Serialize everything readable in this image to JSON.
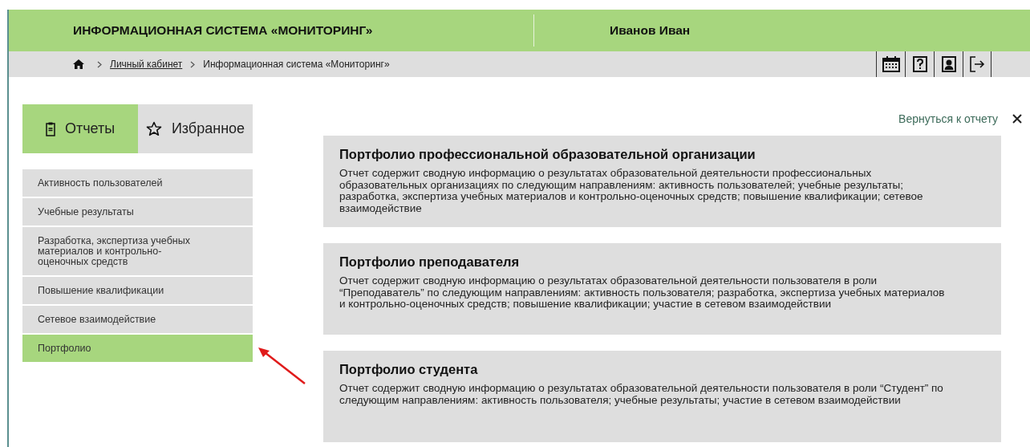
{
  "header": {
    "title": "ИНФОРМАЦИОННАЯ СИСТЕМА «МОНИТОРИНГ»",
    "user": "Иванов Иван"
  },
  "breadcrumbs": [
    {
      "label": "Личный кабинет",
      "link": true
    },
    {
      "label": "Информационная система «Мониторинг»",
      "link": false
    }
  ],
  "tabs": [
    {
      "label": "Отчеты",
      "kind": "reports",
      "selected": true
    },
    {
      "label": "Избранное",
      "kind": "favorites",
      "selected": false
    }
  ],
  "menu": [
    {
      "label": "Активность пользователей",
      "selected": false
    },
    {
      "label": "Учебные результаты",
      "selected": false
    },
    {
      "label": "Разработка, экспертиза учебных материалов и контрольно-оценочных средств",
      "selected": false
    },
    {
      "label": "Повышение квалификации",
      "selected": false
    },
    {
      "label": "Сетевое взаимодействие",
      "selected": false
    },
    {
      "label": "Портфолио",
      "selected": true
    }
  ],
  "back_link": "Вернуться к отчету",
  "cards": [
    {
      "title": "Портфолио профессиональной образовательной организации",
      "text": "Отчет содержит сводную информацию о результатах образовательной деятельности профессиональных образовательных организациях по следующим направлениям: активность пользователей; учебные результаты; разработка, экспертиза учебных материалов и контрольно-оценочных средств; повышение квалификации; сетевое взаимодействие"
    },
    {
      "title": "Портфолио преподавателя",
      "text": "Отчет содержит сводную информацию о результатах образовательной деятельности пользователя в роли “Преподаватель” по следующим направлениям: активность пользователя; разработка, экспертиза учебных материалов и контрольно-оценочных средств; повышение квалификации; участие в сетевом взаимодействии"
    },
    {
      "title": "Портфолио студента",
      "text": "Отчет содержит сводную информацию о результатах образовательной деятельности пользователя в роли “Студент” по следующим направлениям: активность пользователя; учебные результаты; участие в сетевом взаимодействии"
    }
  ]
}
